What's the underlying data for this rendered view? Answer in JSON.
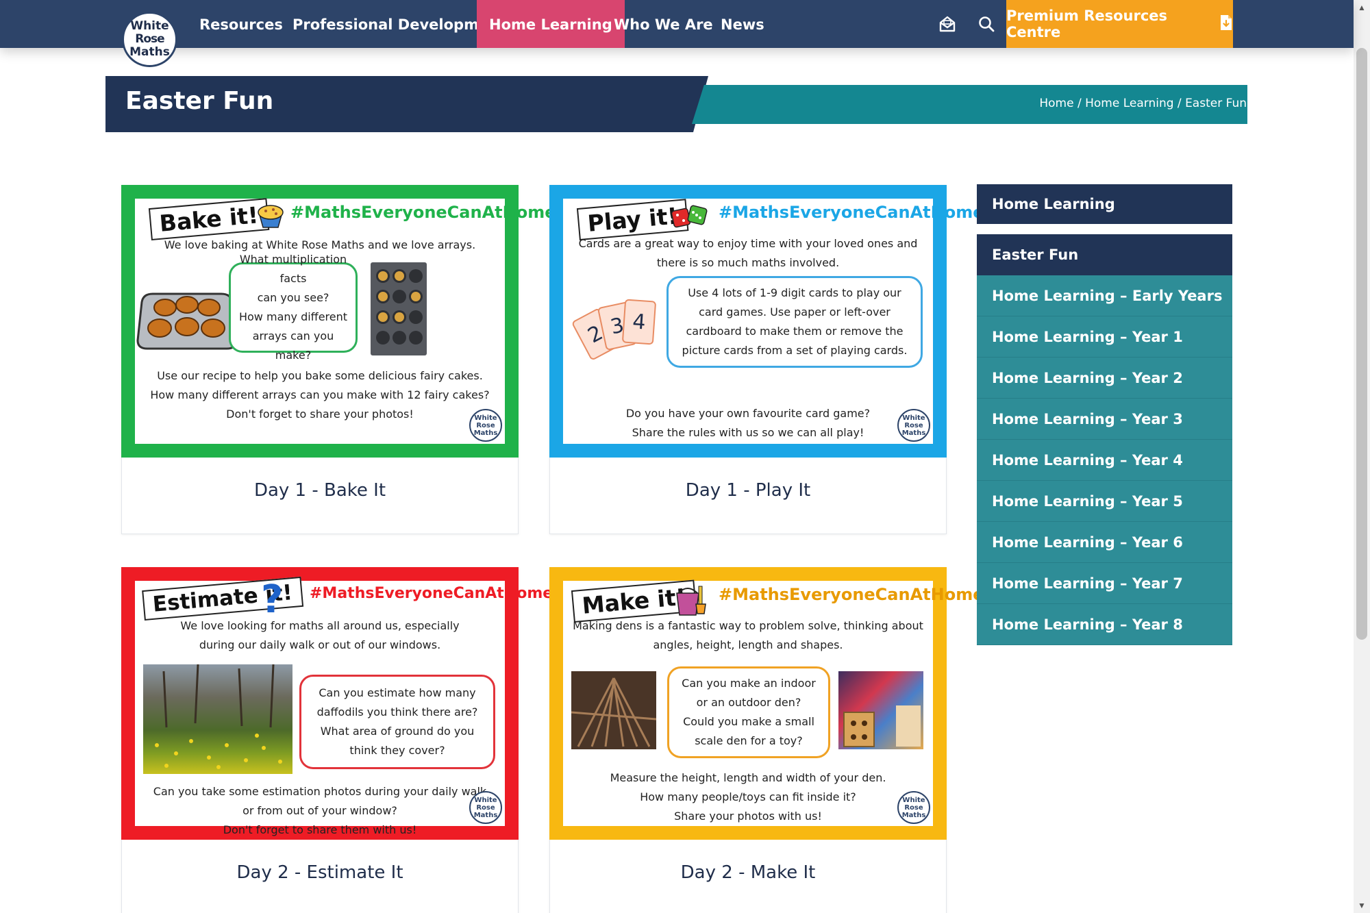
{
  "nav": {
    "logo_line1": "White",
    "logo_line2": "Rose",
    "logo_line3": "Maths",
    "items": [
      "Resources",
      "Professional Development",
      "Home Learning",
      "Who We Are",
      "News"
    ],
    "premium_label": "Premium Resources Centre",
    "colors": {
      "bar": "#2d4469",
      "active": "#d8456f",
      "premium": "#f5a21e"
    },
    "icons": [
      "envelope-open-icon",
      "search-icon",
      "document-download-icon"
    ]
  },
  "header": {
    "title": "Easter Fun",
    "breadcrumb": [
      "Home",
      "Home Learning",
      "Easter Fun"
    ],
    "breadcrumb_sep": " / "
  },
  "cards": [
    {
      "caption": "Day 1 - Bake It",
      "label": "Bake it!",
      "hashtag": "#MathsEveryoneCanAtHome",
      "border_color": "#1fb24a",
      "intro": "We love baking at White Rose Maths and we love arrays.",
      "bubble": [
        "What multiplication facts",
        "can you see?",
        "How many different",
        "arrays can you make?"
      ],
      "outro": [
        "Use our recipe to help you bake some delicious fairy cakes.",
        "How many different arrays can you make with 12 fairy cakes?",
        "Don't forget to share your photos!"
      ]
    },
    {
      "caption": "Day 1 - Play It",
      "label": "Play it!",
      "hashtag": "#MathsEveryoneCanAtHome",
      "border_color": "#1ba6e6",
      "intro": [
        "Cards are a great way to enjoy time with your loved ones and",
        "there is so much maths involved."
      ],
      "bubble": [
        "Use 4 lots of 1-9 digit cards to play our",
        "card games. Use paper or left-over",
        "cardboard to make them or remove the",
        "picture cards from a set of playing cards."
      ],
      "outro": [
        "Do you have your own favourite card game?",
        "Share the rules with us so we can all play!"
      ],
      "digits": [
        "2",
        "3",
        "4"
      ]
    },
    {
      "caption": "Day 2 - Estimate It",
      "label": "Estimate it!",
      "hashtag": "#MathsEveryoneCanAtHome",
      "border_color": "#ee1c25",
      "intro": [
        "We love looking for maths all around us, especially",
        "during our daily walk or out of our windows."
      ],
      "bubble": [
        "Can you estimate how many",
        "daffodils you think there are?",
        "What area of ground do you",
        "think they cover?"
      ],
      "outro": [
        "Can you take some estimation photos during your daily walk",
        "or from out of your window?",
        "Don't forget to share them with us!"
      ]
    },
    {
      "caption": "Day 2 - Make It",
      "label": "Make it!",
      "hashtag": "#MathsEveryoneCanAtHome",
      "border_color": "#f8b811",
      "intro": [
        "Making dens is a fantastic way to problem solve, thinking about",
        "angles, height, length and shapes."
      ],
      "bubble": [
        "Can you make an indoor",
        "or an outdoor den?",
        "Could you make a small",
        "scale den for a toy?"
      ],
      "outro": [
        "Measure the height, length and width of your den.",
        "How many people/toys can fit inside it?",
        "Share your photos with us!"
      ]
    }
  ],
  "mini_logo": [
    "White",
    "Rose",
    "Maths"
  ],
  "sidebar": {
    "top": "Home Learning",
    "items": [
      "Easter Fun",
      "Home Learning – Early Years",
      "Home Learning – Year 1",
      "Home Learning – Year 2",
      "Home Learning – Year 3",
      "Home Learning – Year 4",
      "Home Learning – Year 5",
      "Home Learning – Year 6",
      "Home Learning – Year 7",
      "Home Learning – Year 8"
    ]
  }
}
